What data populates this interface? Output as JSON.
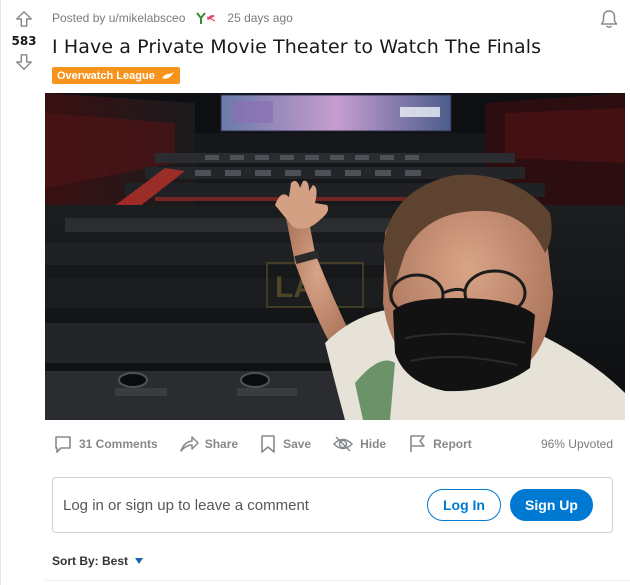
{
  "post": {
    "author_line": "Posted by u/mikelabsceo",
    "age": "25 days ago",
    "votes": "583",
    "title": "I Have a Private Movie Theater to Watch The Finals",
    "flair": "Overwatch League"
  },
  "image": {
    "watermark": "LA"
  },
  "actions": {
    "comments": "31 Comments",
    "share": "Share",
    "save": "Save",
    "hide": "Hide",
    "report": "Report",
    "upvoted": "96% Upvoted"
  },
  "comment": {
    "prompt": "Log in or sign up to leave a comment",
    "login": "Log In",
    "signup": "Sign Up"
  },
  "sort": {
    "label": "Sort By: Best"
  },
  "colors": {
    "flair_bg": "#f7941d",
    "primary_blue": "#0079d3",
    "muted_text": "#878a8c"
  },
  "icons": [
    "upvote-icon",
    "downvote-icon",
    "award-icon",
    "notification-bell-icon",
    "comment-icon",
    "share-icon",
    "save-icon",
    "hide-icon",
    "report-icon",
    "caret-down-icon"
  ]
}
